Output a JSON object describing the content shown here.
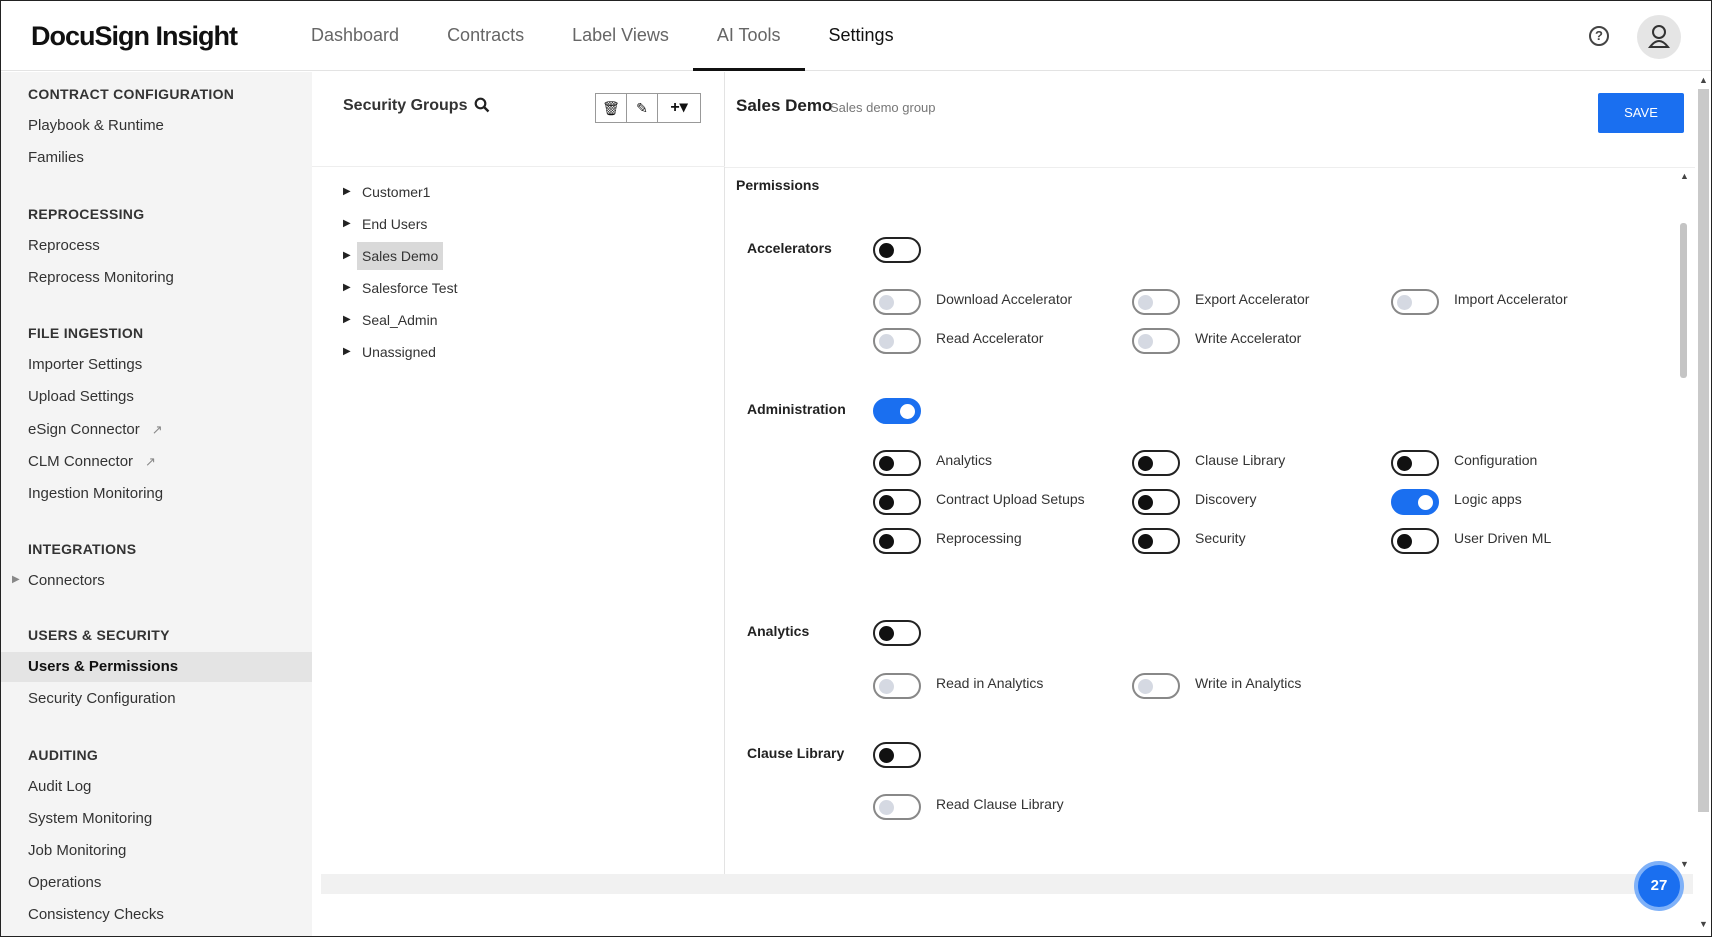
{
  "header": {
    "logo": "DocuSign Insight",
    "nav": [
      {
        "label": "Dashboard"
      },
      {
        "label": "Contracts"
      },
      {
        "label": "Label Views"
      },
      {
        "label": "AI Tools"
      },
      {
        "label": "Settings"
      }
    ],
    "help_icon": "?"
  },
  "sidebar": {
    "sections": [
      {
        "title": "CONTRACT CONFIGURATION",
        "items": [
          "Playbook & Runtime",
          "Families"
        ]
      },
      {
        "title": "REPROCESSING",
        "items": [
          "Reprocess",
          "Reprocess Monitoring"
        ]
      },
      {
        "title": "FILE INGESTION",
        "items": [
          "Importer Settings",
          "Upload Settings",
          "eSign Connector",
          "CLM Connector",
          "Ingestion Monitoring"
        ]
      },
      {
        "title": "INTEGRATIONS",
        "items": [
          "Connectors"
        ]
      },
      {
        "title": "USERS & SECURITY",
        "items": [
          "Users & Permissions",
          "Security Configuration"
        ]
      },
      {
        "title": "AUDITING",
        "items": [
          "Audit Log",
          "System Monitoring",
          "Job Monitoring",
          "Operations",
          "Consistency Checks"
        ]
      }
    ],
    "active_item": "Users & Permissions"
  },
  "groups": {
    "title": "Security Groups",
    "tree": [
      "Customer1",
      "End Users",
      "Sales Demo",
      "Salesforce Test",
      "Seal_Admin",
      "Unassigned"
    ],
    "selected": "Sales Demo"
  },
  "details": {
    "title": "Sales Demo",
    "subtitle": "Sales demo group",
    "save_label": "SAVE",
    "permissions_title": "Permissions",
    "categories": [
      {
        "label": "Accelerators",
        "state": "off",
        "perms": [
          {
            "label": "Download Accelerator",
            "state": "disabled"
          },
          {
            "label": "Export Accelerator",
            "state": "disabled"
          },
          {
            "label": "Import Accelerator",
            "state": "disabled"
          },
          {
            "label": "Read Accelerator",
            "state": "disabled"
          },
          {
            "label": "Write Accelerator",
            "state": "disabled"
          }
        ]
      },
      {
        "label": "Administration",
        "state": "on",
        "perms": [
          {
            "label": "Analytics",
            "state": "off"
          },
          {
            "label": "Clause Library",
            "state": "off"
          },
          {
            "label": "Configuration",
            "state": "off"
          },
          {
            "label": "Contract Upload Setups",
            "state": "off"
          },
          {
            "label": "Discovery",
            "state": "off"
          },
          {
            "label": "Logic apps",
            "state": "on"
          },
          {
            "label": "Reprocessing",
            "state": "off"
          },
          {
            "label": "Security",
            "state": "off"
          },
          {
            "label": "User Driven ML",
            "state": "off"
          }
        ]
      },
      {
        "label": "Analytics",
        "state": "off",
        "perms": [
          {
            "label": "Read in Analytics",
            "state": "disabled"
          },
          {
            "label": "Write in Analytics",
            "state": "disabled"
          }
        ]
      },
      {
        "label": "Clause Library",
        "state": "off",
        "perms": [
          {
            "label": "Read Clause Library",
            "state": "disabled"
          }
        ]
      }
    ]
  },
  "badge": {
    "count": "27"
  },
  "colors": {
    "accent": "#1a6ff0",
    "sidebar_bg": "#f4f4f4"
  },
  "icons": [
    "help-icon",
    "avatar-icon",
    "search-icon",
    "trash-icon",
    "pencil-icon",
    "plus-icon",
    "external-link-icon"
  ]
}
